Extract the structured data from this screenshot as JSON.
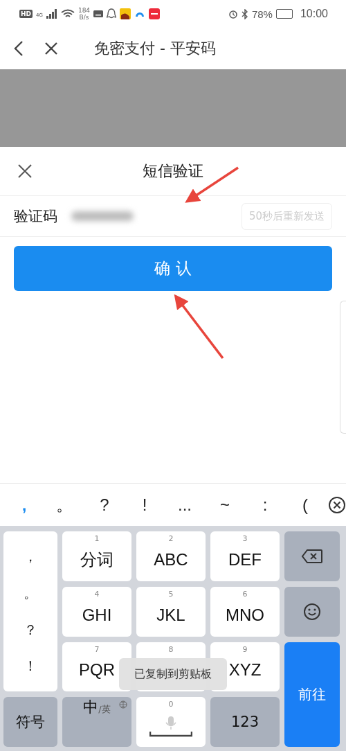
{
  "status_bar": {
    "hd": "HD",
    "network": "4G",
    "speed_value": "184",
    "speed_unit": "B/s",
    "battery": "78%",
    "time": "10:00"
  },
  "nav": {
    "title": "免密支付 - 平安码"
  },
  "sheet": {
    "title": "短信验证",
    "field_label": "验证码",
    "resend": "50秒后重新发送",
    "resend_disabled": true,
    "confirm": "确 认"
  },
  "keyboard": {
    "candidates": [
      {
        "text": ",",
        "selected": true
      },
      {
        "text": "。",
        "selected": false
      },
      {
        "text": "?",
        "selected": false
      },
      {
        "text": "!",
        "selected": false
      },
      {
        "text": "...",
        "selected": false
      },
      {
        "text": "~",
        "selected": false
      },
      {
        "text": ":",
        "selected": false
      },
      {
        "text": "(",
        "selected": false
      }
    ],
    "keys": [
      {
        "kind": "side",
        "items": [
          "，",
          "。",
          "？",
          "！"
        ]
      },
      {
        "kind": "t9",
        "number": "1",
        "label": "分词"
      },
      {
        "kind": "t9",
        "number": "2",
        "label": "ABC"
      },
      {
        "kind": "t9",
        "number": "3",
        "label": "DEF"
      },
      {
        "kind": "backspace"
      },
      {
        "kind": "t9",
        "number": "4",
        "label": "GHI"
      },
      {
        "kind": "t9",
        "number": "5",
        "label": "JKL"
      },
      {
        "kind": "t9",
        "number": "6",
        "label": "MNO"
      },
      {
        "kind": "emoji"
      },
      {
        "kind": "t9",
        "number": "7",
        "label": "PQR"
      },
      {
        "kind": "t9",
        "number": "8"
      },
      {
        "kind": "t9",
        "number": "9",
        "label": "XYZ"
      },
      {
        "kind": "go",
        "label": "前往"
      },
      {
        "kind": "func",
        "label": "符号"
      },
      {
        "kind": "lang",
        "label": "中",
        "sub": "/英"
      },
      {
        "kind": "space",
        "number": "0"
      },
      {
        "kind": "func",
        "label": "123"
      }
    ]
  },
  "toast": "已复制到剪贴板"
}
